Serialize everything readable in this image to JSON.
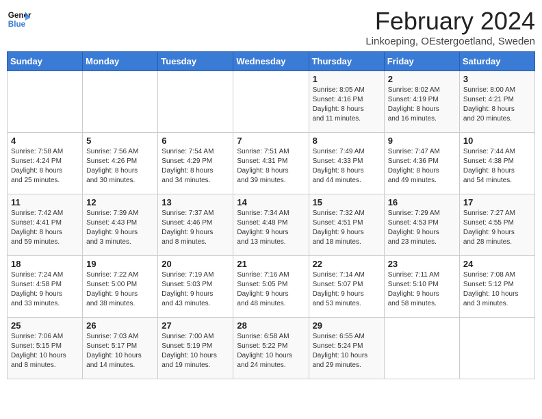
{
  "header": {
    "logo_line1": "General",
    "logo_line2": "Blue",
    "month_title": "February 2024",
    "location": "Linkoeping, OEstergoetland, Sweden"
  },
  "days_of_week": [
    "Sunday",
    "Monday",
    "Tuesday",
    "Wednesday",
    "Thursday",
    "Friday",
    "Saturday"
  ],
  "weeks": [
    [
      {
        "day": "",
        "detail": ""
      },
      {
        "day": "",
        "detail": ""
      },
      {
        "day": "",
        "detail": ""
      },
      {
        "day": "",
        "detail": ""
      },
      {
        "day": "1",
        "detail": "Sunrise: 8:05 AM\nSunset: 4:16 PM\nDaylight: 8 hours\nand 11 minutes."
      },
      {
        "day": "2",
        "detail": "Sunrise: 8:02 AM\nSunset: 4:19 PM\nDaylight: 8 hours\nand 16 minutes."
      },
      {
        "day": "3",
        "detail": "Sunrise: 8:00 AM\nSunset: 4:21 PM\nDaylight: 8 hours\nand 20 minutes."
      }
    ],
    [
      {
        "day": "4",
        "detail": "Sunrise: 7:58 AM\nSunset: 4:24 PM\nDaylight: 8 hours\nand 25 minutes."
      },
      {
        "day": "5",
        "detail": "Sunrise: 7:56 AM\nSunset: 4:26 PM\nDaylight: 8 hours\nand 30 minutes."
      },
      {
        "day": "6",
        "detail": "Sunrise: 7:54 AM\nSunset: 4:29 PM\nDaylight: 8 hours\nand 34 minutes."
      },
      {
        "day": "7",
        "detail": "Sunrise: 7:51 AM\nSunset: 4:31 PM\nDaylight: 8 hours\nand 39 minutes."
      },
      {
        "day": "8",
        "detail": "Sunrise: 7:49 AM\nSunset: 4:33 PM\nDaylight: 8 hours\nand 44 minutes."
      },
      {
        "day": "9",
        "detail": "Sunrise: 7:47 AM\nSunset: 4:36 PM\nDaylight: 8 hours\nand 49 minutes."
      },
      {
        "day": "10",
        "detail": "Sunrise: 7:44 AM\nSunset: 4:38 PM\nDaylight: 8 hours\nand 54 minutes."
      }
    ],
    [
      {
        "day": "11",
        "detail": "Sunrise: 7:42 AM\nSunset: 4:41 PM\nDaylight: 8 hours\nand 59 minutes."
      },
      {
        "day": "12",
        "detail": "Sunrise: 7:39 AM\nSunset: 4:43 PM\nDaylight: 9 hours\nand 3 minutes."
      },
      {
        "day": "13",
        "detail": "Sunrise: 7:37 AM\nSunset: 4:46 PM\nDaylight: 9 hours\nand 8 minutes."
      },
      {
        "day": "14",
        "detail": "Sunrise: 7:34 AM\nSunset: 4:48 PM\nDaylight: 9 hours\nand 13 minutes."
      },
      {
        "day": "15",
        "detail": "Sunrise: 7:32 AM\nSunset: 4:51 PM\nDaylight: 9 hours\nand 18 minutes."
      },
      {
        "day": "16",
        "detail": "Sunrise: 7:29 AM\nSunset: 4:53 PM\nDaylight: 9 hours\nand 23 minutes."
      },
      {
        "day": "17",
        "detail": "Sunrise: 7:27 AM\nSunset: 4:55 PM\nDaylight: 9 hours\nand 28 minutes."
      }
    ],
    [
      {
        "day": "18",
        "detail": "Sunrise: 7:24 AM\nSunset: 4:58 PM\nDaylight: 9 hours\nand 33 minutes."
      },
      {
        "day": "19",
        "detail": "Sunrise: 7:22 AM\nSunset: 5:00 PM\nDaylight: 9 hours\nand 38 minutes."
      },
      {
        "day": "20",
        "detail": "Sunrise: 7:19 AM\nSunset: 5:03 PM\nDaylight: 9 hours\nand 43 minutes."
      },
      {
        "day": "21",
        "detail": "Sunrise: 7:16 AM\nSunset: 5:05 PM\nDaylight: 9 hours\nand 48 minutes."
      },
      {
        "day": "22",
        "detail": "Sunrise: 7:14 AM\nSunset: 5:07 PM\nDaylight: 9 hours\nand 53 minutes."
      },
      {
        "day": "23",
        "detail": "Sunrise: 7:11 AM\nSunset: 5:10 PM\nDaylight: 9 hours\nand 58 minutes."
      },
      {
        "day": "24",
        "detail": "Sunrise: 7:08 AM\nSunset: 5:12 PM\nDaylight: 10 hours\nand 3 minutes."
      }
    ],
    [
      {
        "day": "25",
        "detail": "Sunrise: 7:06 AM\nSunset: 5:15 PM\nDaylight: 10 hours\nand 8 minutes."
      },
      {
        "day": "26",
        "detail": "Sunrise: 7:03 AM\nSunset: 5:17 PM\nDaylight: 10 hours\nand 14 minutes."
      },
      {
        "day": "27",
        "detail": "Sunrise: 7:00 AM\nSunset: 5:19 PM\nDaylight: 10 hours\nand 19 minutes."
      },
      {
        "day": "28",
        "detail": "Sunrise: 6:58 AM\nSunset: 5:22 PM\nDaylight: 10 hours\nand 24 minutes."
      },
      {
        "day": "29",
        "detail": "Sunrise: 6:55 AM\nSunset: 5:24 PM\nDaylight: 10 hours\nand 29 minutes."
      },
      {
        "day": "",
        "detail": ""
      },
      {
        "day": "",
        "detail": ""
      }
    ]
  ]
}
